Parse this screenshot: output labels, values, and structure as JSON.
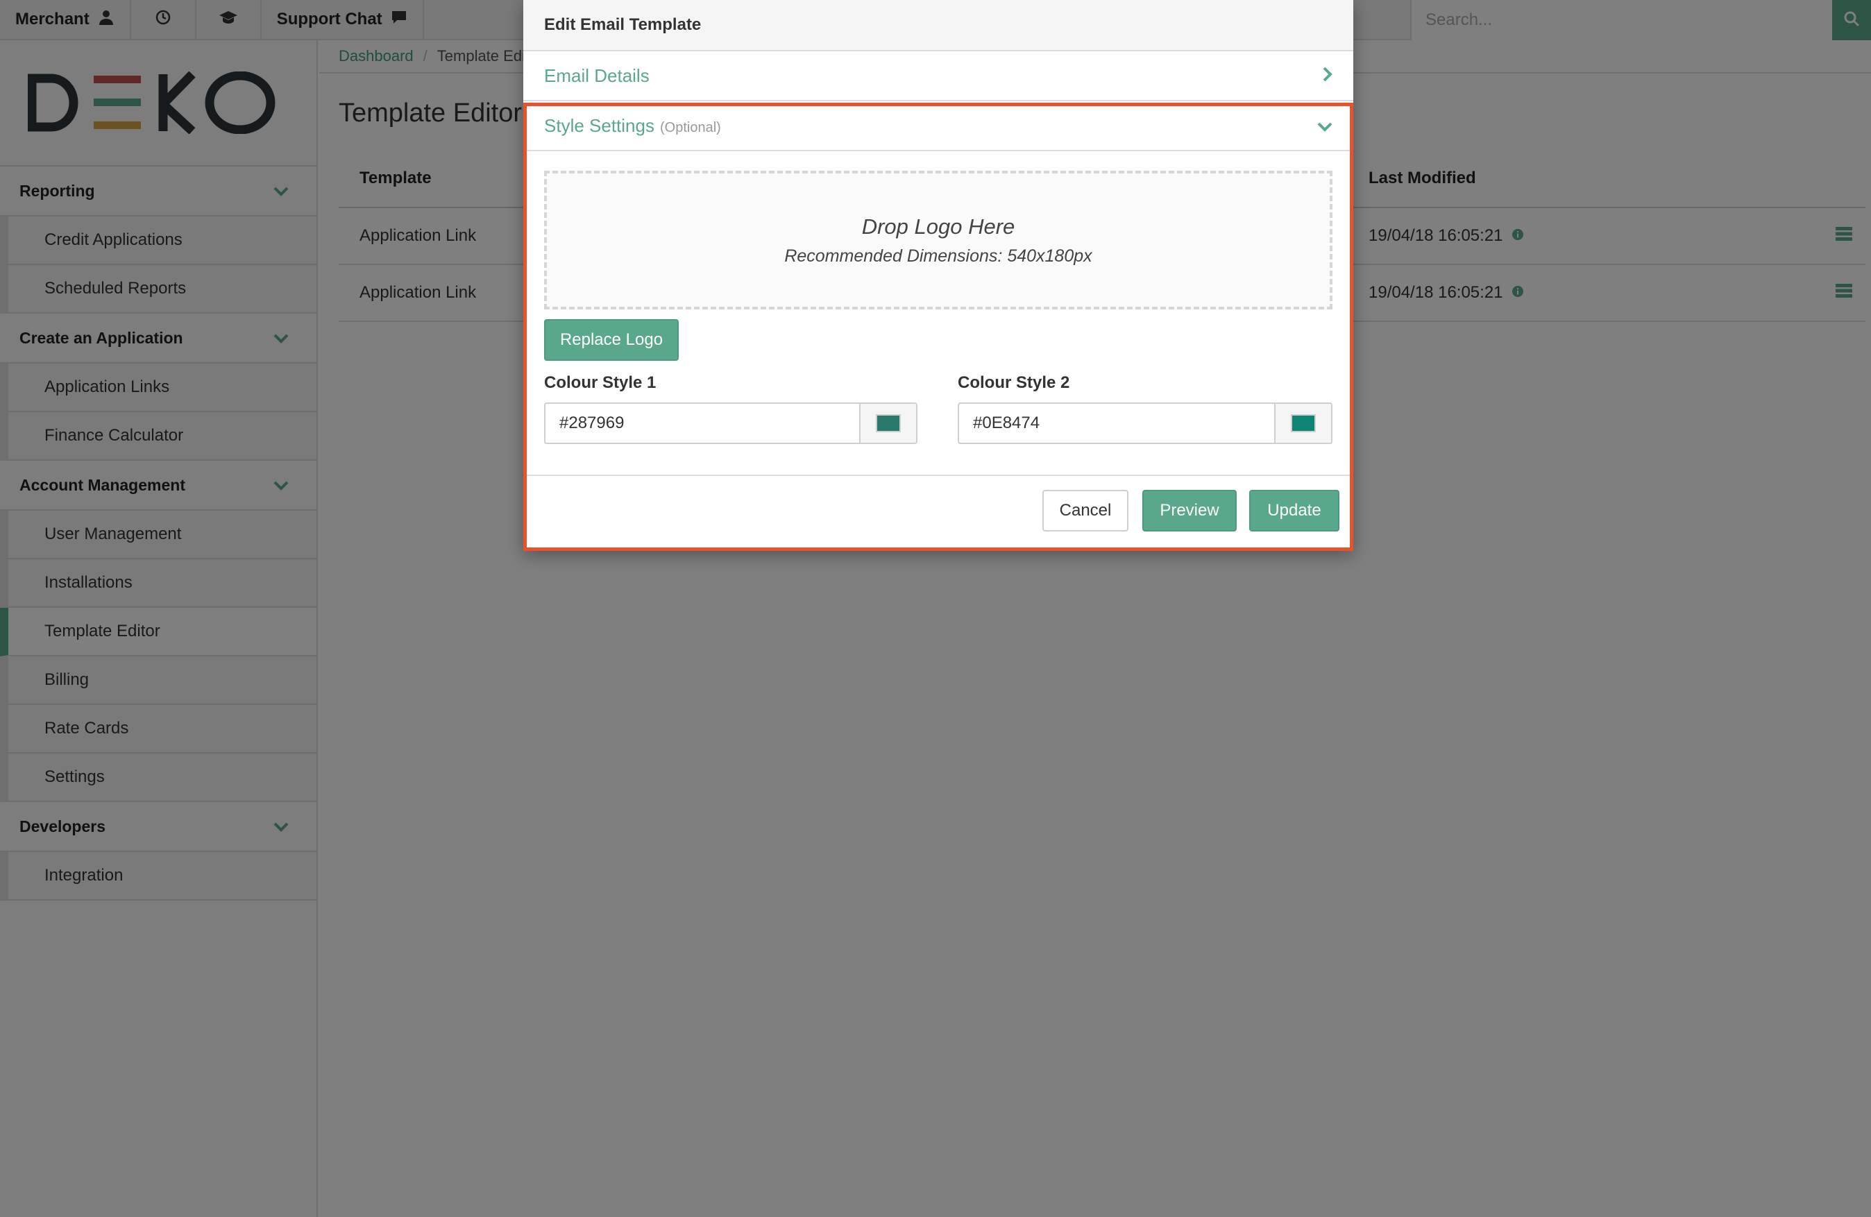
{
  "topbar": {
    "merchant_label": "Merchant",
    "support_chat_label": "Support Chat",
    "search_placeholder": "Search..."
  },
  "sidebar": {
    "logo_text": "DEKO",
    "sections": [
      {
        "title": "Reporting",
        "items": [
          "Credit Applications",
          "Scheduled Reports"
        ]
      },
      {
        "title": "Create an Application",
        "items": [
          "Application Links",
          "Finance Calculator"
        ]
      },
      {
        "title": "Account Management",
        "items": [
          "User Management",
          "Installations",
          "Template Editor",
          "Billing",
          "Rate Cards",
          "Settings"
        ]
      },
      {
        "title": "Developers",
        "items": [
          "Integration"
        ]
      }
    ],
    "active_item": "Template Editor"
  },
  "breadcrumb": {
    "home": "Dashboard",
    "separator": "/",
    "current": "Template Edit"
  },
  "page_title": "Template Editor",
  "table": {
    "columns": [
      "Template",
      "Last Modified"
    ],
    "rows": [
      {
        "template": "Application Link",
        "last_modified": "19/04/18 16:05:21"
      },
      {
        "template": "Application Link",
        "last_modified": "19/04/18 16:05:21"
      }
    ]
  },
  "modal": {
    "title": "Edit Email Template",
    "email_details_label": "Email Details",
    "style_settings_label": "Style Settings",
    "style_settings_optional": "(Optional)",
    "dropzone_title": "Drop Logo Here",
    "dropzone_subtitle": "Recommended Dimensions: 540x180px",
    "replace_logo_label": "Replace Logo",
    "colour_style_1_label": "Colour Style 1",
    "colour_style_1_value": "#287969",
    "colour_style_2_label": "Colour Style 2",
    "colour_style_2_value": "#0E8474",
    "cancel_label": "Cancel",
    "preview_label": "Preview",
    "update_label": "Update"
  },
  "colors": {
    "accent": "#5aa88b",
    "highlight_border": "#e8532b",
    "logo_bars": [
      "#c0504d",
      "#5aa88b",
      "#d9a441"
    ]
  }
}
